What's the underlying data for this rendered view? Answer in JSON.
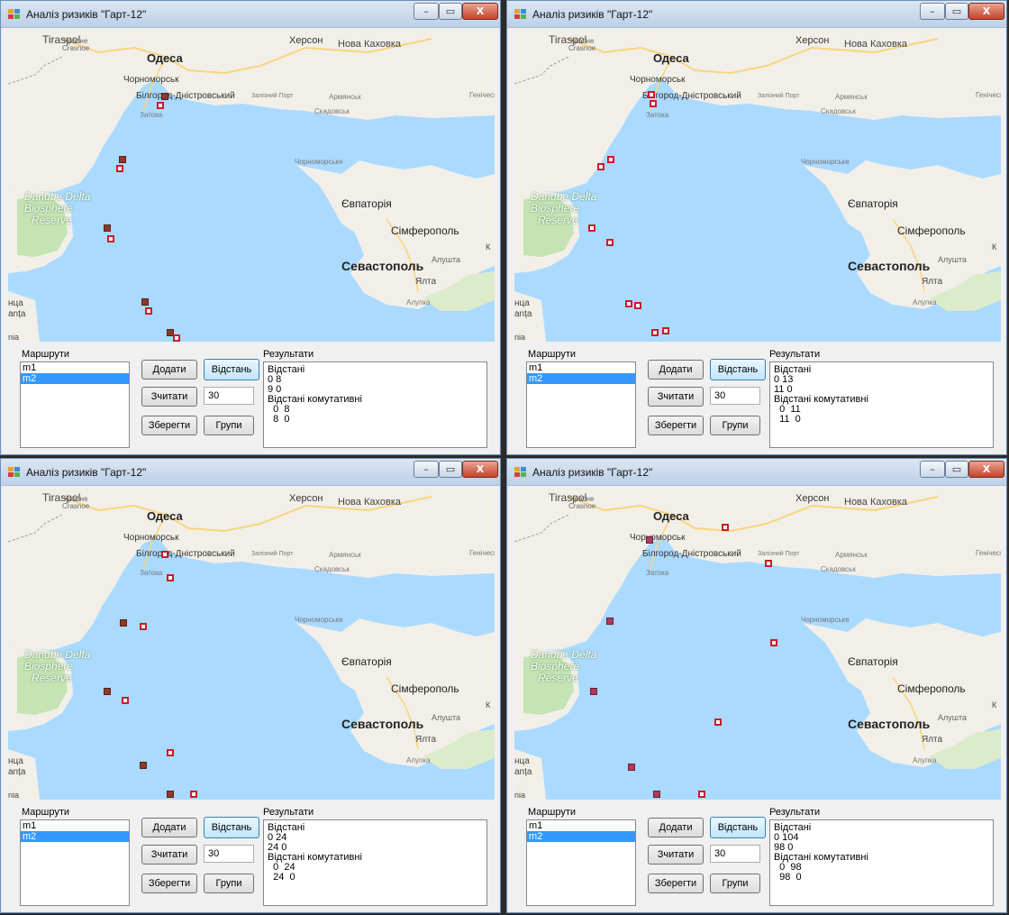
{
  "window_title": "Аналіз ризиків \"Гарт-12\"",
  "window_buttons": {
    "minimize": "–",
    "maximize": "▭",
    "close": "X"
  },
  "map_labels": {
    "tiraspol": "Tiraspol",
    "kherson": "Херсон",
    "nova_kakhovka": "Нова Каховка",
    "odesa": "Одеса",
    "krasne": "Красне",
    "crasnoe": "Crasnoe",
    "chornomorsk": "Чорноморськ",
    "bilhorod": "Білгород-Дністровський",
    "zalizny_port": "Залізний Порт",
    "armiansk": "Армянськ",
    "henichesk": "Генічеськ",
    "skadovsk": "Скадовськ",
    "zatoka": "Затока",
    "chornomorske": "Чорноморське",
    "danube": "Danube Delta",
    "biosphere": "Biosphere",
    "reserve": "Reserve",
    "yevpatoriia": "Євпаторія",
    "simferopol": "Сімферополь",
    "sevastopol": "Севастополь",
    "alushta": "Алушта",
    "yalta": "Ялта",
    "alupka": "Алупка",
    "ntsa": "нца",
    "anta": "anța",
    "nia": "nia",
    "k": "К"
  },
  "colors": {
    "marker_red": "#cc1a2a",
    "marker_filled": "#8b3a2a",
    "selected": "#3399ff",
    "sea": "#aadaff",
    "land": "#f2efe9"
  },
  "panels": [
    {
      "routes_label": "Маршрути",
      "results_label": "Результати",
      "routes": [
        {
          "label": "m1",
          "selected": false
        },
        {
          "label": "m2",
          "selected": true
        }
      ],
      "buttons": {
        "add": "Додати",
        "distance": "Відстань",
        "read": "Зчитати",
        "save": "Зберегти",
        "groups": "Групи"
      },
      "input_value": "30",
      "results": [
        "Відстані",
        "0 8",
        "9 0",
        "Відстані комутативні",
        "  0  8",
        "  8  0"
      ]
    },
    {
      "routes_label": "Маршрути",
      "results_label": "Результати",
      "routes": [
        {
          "label": "m1",
          "selected": false
        },
        {
          "label": "m2",
          "selected": true
        }
      ],
      "buttons": {
        "add": "Додати",
        "distance": "Відстань",
        "read": "Зчитати",
        "save": "Зберегти",
        "groups": "Групи"
      },
      "input_value": "30",
      "results": [
        "Відстані",
        "0 13",
        "11 0",
        "Відстані комутативні",
        "  0  11",
        "  11  0"
      ]
    },
    {
      "routes_label": "Маршрути",
      "results_label": "Результати",
      "routes": [
        {
          "label": "m1",
          "selected": false
        },
        {
          "label": "m2",
          "selected": true
        }
      ],
      "buttons": {
        "add": "Додати",
        "distance": "Відстань",
        "read": "Зчитати",
        "save": "Зберегти",
        "groups": "Групи"
      },
      "input_value": "30",
      "results": [
        "Відстані",
        "0 24",
        "24 0",
        "Відстані комутативні",
        "  0  24",
        "  24  0"
      ]
    },
    {
      "routes_label": "Маршрути",
      "results_label": "Результати",
      "routes": [
        {
          "label": "m1",
          "selected": false
        },
        {
          "label": "m2",
          "selected": true
        }
      ],
      "buttons": {
        "add": "Додати",
        "distance": "Відстань",
        "read": "Зчитати",
        "save": "Зберегти",
        "groups": "Групи"
      },
      "input_value": "30",
      "results": [
        "Відстані",
        "0 104",
        "98 0",
        "Відстані комутативні",
        "  0  98",
        "  98  0"
      ]
    }
  ]
}
